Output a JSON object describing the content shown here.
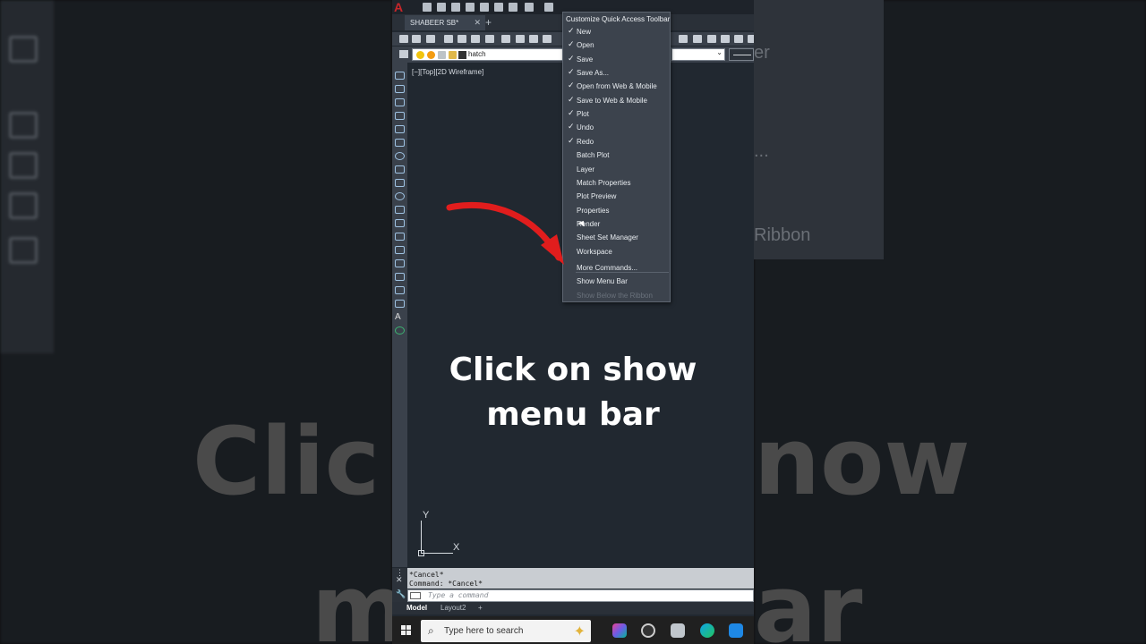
{
  "quick_access": {
    "doc_tab": "SHABEER SB*",
    "tab_close": "✕",
    "tab_add": "+"
  },
  "toolbar": {
    "layer_name": "hatch"
  },
  "viewport": {
    "label": "[−][Top][2D Wireframe]",
    "ucs_x": "X",
    "ucs_y": "Y"
  },
  "qat_menu": {
    "title": "Customize Quick Access Toolbar",
    "items": [
      {
        "label": "New",
        "checked": true,
        "enabled": true
      },
      {
        "label": "Open",
        "checked": true,
        "enabled": true
      },
      {
        "label": "Save",
        "checked": true,
        "enabled": true
      },
      {
        "label": "Save As...",
        "checked": true,
        "enabled": true
      },
      {
        "label": "Open from Web & Mobile",
        "checked": true,
        "enabled": true
      },
      {
        "label": "Save to Web & Mobile",
        "checked": true,
        "enabled": true
      },
      {
        "label": "Plot",
        "checked": true,
        "enabled": true
      },
      {
        "label": "Undo",
        "checked": true,
        "enabled": true
      },
      {
        "label": "Redo",
        "checked": true,
        "enabled": true
      },
      {
        "label": "Batch Plot",
        "checked": false,
        "enabled": true
      },
      {
        "label": "Layer",
        "checked": false,
        "enabled": true
      },
      {
        "label": "Match Properties",
        "checked": false,
        "enabled": true
      },
      {
        "label": "Plot Preview",
        "checked": false,
        "enabled": true
      },
      {
        "label": "Properties",
        "checked": false,
        "enabled": true
      },
      {
        "label": "Render",
        "checked": false,
        "enabled": true
      },
      {
        "label": "Sheet Set Manager",
        "checked": false,
        "enabled": true
      },
      {
        "label": "Workspace",
        "checked": false,
        "enabled": true
      },
      {
        "label": "More Commands...",
        "checked": false,
        "enabled": true
      },
      {
        "label": "Show Menu Bar",
        "checked": false,
        "enabled": true
      },
      {
        "label": "Show Below the Ribbon",
        "checked": false,
        "enabled": false
      }
    ]
  },
  "command_line": {
    "line1": "*Cancel*",
    "line2": "Command: *Cancel*",
    "placeholder": "Type a command"
  },
  "layout_tabs": [
    "Model",
    "Layout2"
  ],
  "layout_add": "+",
  "taskbar": {
    "search_placeholder": "Type here to search"
  },
  "overlay": {
    "caption_line1": "Click on show",
    "caption_line2": "menu bar",
    "bg_text_top": "Clic",
    "bg_text_top_right": "now",
    "bg_text_bottom_left": "m",
    "bg_text_bottom_right": "ar",
    "bg_right_menu_1": "er",
    "bg_right_menu_2": "...",
    "bg_right_menu_3": "Ribbon",
    "arrow_color": "#e11d1d"
  },
  "colors": {
    "app_bg": "#212830",
    "menu_bg": "#3c434d",
    "autocad_red": "#c8262a"
  }
}
